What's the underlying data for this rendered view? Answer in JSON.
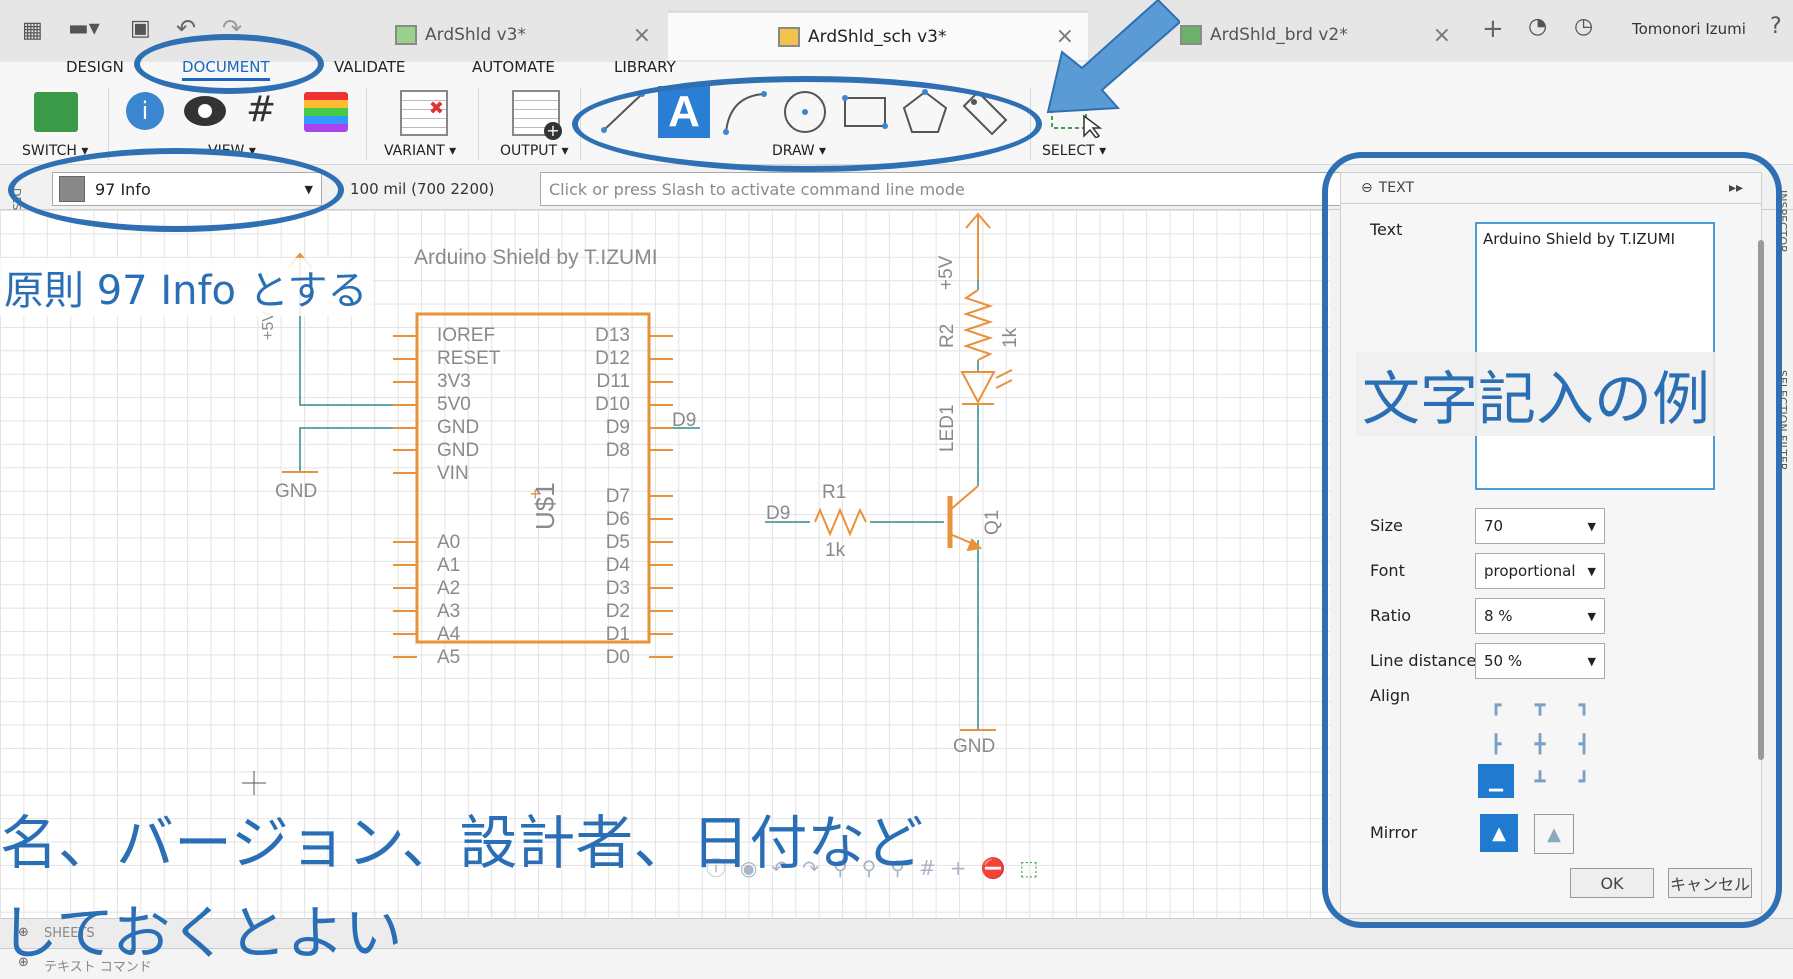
{
  "tabs": [
    {
      "label": "ArdShld v3*"
    },
    {
      "label": "ArdShld_sch v3*"
    },
    {
      "label": "ArdShld_brd v2*"
    }
  ],
  "user": "Tomonori Izumi",
  "ribbon_tabs": [
    "DESIGN",
    "DOCUMENT",
    "VALIDATE",
    "AUTOMATE",
    "LIBRARY"
  ],
  "groups": {
    "switch": "SWITCH ▾",
    "view": "VIEW ▾",
    "variant": "VARIANT ▾",
    "output": "OUTPUT ▾",
    "draw": "DRAW ▾",
    "select": "SELECT ▾"
  },
  "layer_select": {
    "value": "97 Info"
  },
  "grid_info": "100 mil (700 2200)",
  "command_placeholder": "Click or press Slash to activate command line mode",
  "left_vertical_label": "DESIGN MANAGER",
  "canvas": {
    "title_text": "Arduino Shield by T.IZUMI",
    "ic_label": "U$1",
    "pins_left": [
      "IOREF",
      "RESET",
      "3V3",
      "5V0",
      "GND",
      "GND",
      "VIN",
      "A0",
      "A1",
      "A2",
      "A3",
      "A4",
      "A5"
    ],
    "pins_right": [
      "D13",
      "D12",
      "D11",
      "D10",
      "D9",
      "D8",
      "D7",
      "D6",
      "D5",
      "D4",
      "D3",
      "D2",
      "D1",
      "D0"
    ],
    "net_d9_right": "D9",
    "net_d9_left": "D9",
    "gnd_left": "GND",
    "gnd_right": "GND",
    "plus5v_left": "+5V",
    "plus5v_right": "+5V",
    "r2": "R2",
    "r2_val": "1k",
    "led": "LED1",
    "r1": "R1",
    "r1_val": "1k",
    "q1": "Q1"
  },
  "panel": {
    "header": "TEXT",
    "text_label": "Text",
    "text_value": "Arduino Shield by T.IZUMI",
    "size_label": "Size",
    "size_value": "70",
    "font_label": "Font",
    "font_value": "proportional",
    "ratio_label": "Ratio",
    "ratio_value": "8 %",
    "line_label": "Line distance",
    "line_value": "50 %",
    "align_label": "Align",
    "mirror_label": "Mirror",
    "ok": "OK",
    "cancel": "キャンセル",
    "right_vertical_1": "INSPECTOR",
    "right_vertical_2": "SELECTION FILTER"
  },
  "bottom": {
    "sheets": "SHEETS",
    "text_command": "テキスト コマンド"
  },
  "annotations": {
    "top_left": "原則 97 Info とする",
    "panel_example": "文字記入の例",
    "bottom_line1": "名、バージョン、設計者、日付など",
    "bottom_line2": "しておくとよい"
  },
  "colors": {
    "accent": "#2a6fb5",
    "part": "#e8923a",
    "wire": "#2e8b8b",
    "arrow": "#5b9bd5"
  }
}
